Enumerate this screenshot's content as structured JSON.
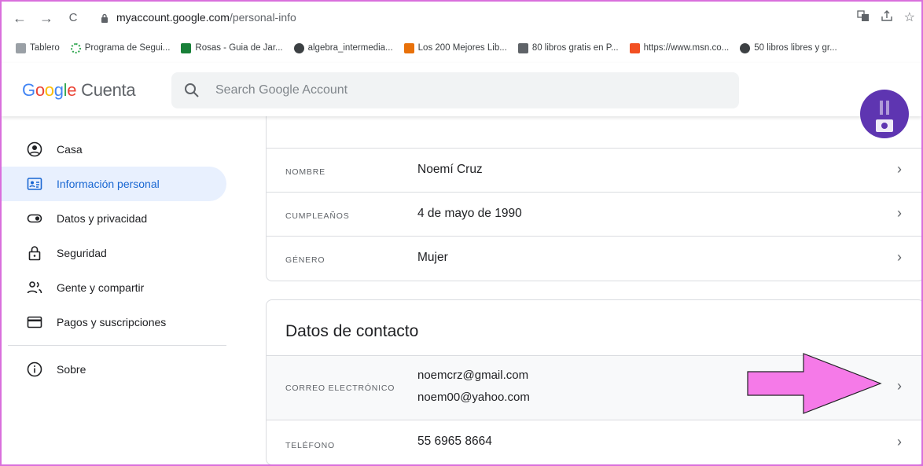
{
  "browser": {
    "nav": {
      "back": "←",
      "forward": "→",
      "reload": "C"
    },
    "url_host": "myaccount.google.com",
    "url_path": "/personal-info",
    "bookmarks": [
      {
        "label": "Tablero",
        "icon": "folder-icon",
        "color": "#9aa0a6"
      },
      {
        "label": "Programa de Segui...",
        "icon": "dots-icon",
        "color": "#34a853"
      },
      {
        "label": "Rosas - Guia de Jar...",
        "icon": "leaf-icon",
        "color": "#188038"
      },
      {
        "label": "algebra_intermedia...",
        "icon": "globe-icon",
        "color": "#3c4043"
      },
      {
        "label": "Los 200 Mejores Lib...",
        "icon": "book-icon",
        "color": "#e8710a"
      },
      {
        "label": "80 libros gratis en P...",
        "icon": "library-icon",
        "color": "#5f6368"
      },
      {
        "label": "https://www.msn.co...",
        "icon": "windows-icon",
        "color": "#f25022"
      },
      {
        "label": "50 libros libres y gr...",
        "icon": "globe-icon",
        "color": "#3c4043"
      }
    ]
  },
  "header": {
    "logo_google": "Google",
    "logo_product": "Cuenta",
    "search_placeholder": "Search Google Account"
  },
  "sidebar": {
    "items": [
      {
        "label": "Casa",
        "icon": "account-circle-icon",
        "active": false
      },
      {
        "label": "Información personal",
        "icon": "id-card-icon",
        "active": true
      },
      {
        "label": "Datos y privacidad",
        "icon": "toggle-icon",
        "active": false
      },
      {
        "label": "Seguridad",
        "icon": "lock-icon",
        "active": false
      },
      {
        "label": "Gente y compartir",
        "icon": "people-icon",
        "active": false
      },
      {
        "label": "Pagos y suscripciones",
        "icon": "credit-card-icon",
        "active": false
      },
      {
        "label": "Sobre",
        "icon": "info-icon",
        "active": false
      }
    ]
  },
  "basic_info": {
    "rows": [
      {
        "key": "NOMBRE",
        "value": "Noemí Cruz"
      },
      {
        "key": "CUMPLEAÑOS",
        "value": "4 de mayo de 1990"
      },
      {
        "key": "GÉNERO",
        "value": "Mujer"
      }
    ]
  },
  "contact": {
    "title": "Datos de contacto",
    "email_key": "CORREO ELECTRÓNICO",
    "emails": [
      "noemcrz@gmail.com",
      "noem00@yahoo.com"
    ],
    "phone_key": "TELÉFONO",
    "phone": "55 6965 8664"
  },
  "colors": {
    "accent": "#1967d2",
    "active_bg": "#e8f0fe",
    "annotation": "#f57ae8",
    "frame": "#d96fdc",
    "avatar": "#5e35b1"
  }
}
